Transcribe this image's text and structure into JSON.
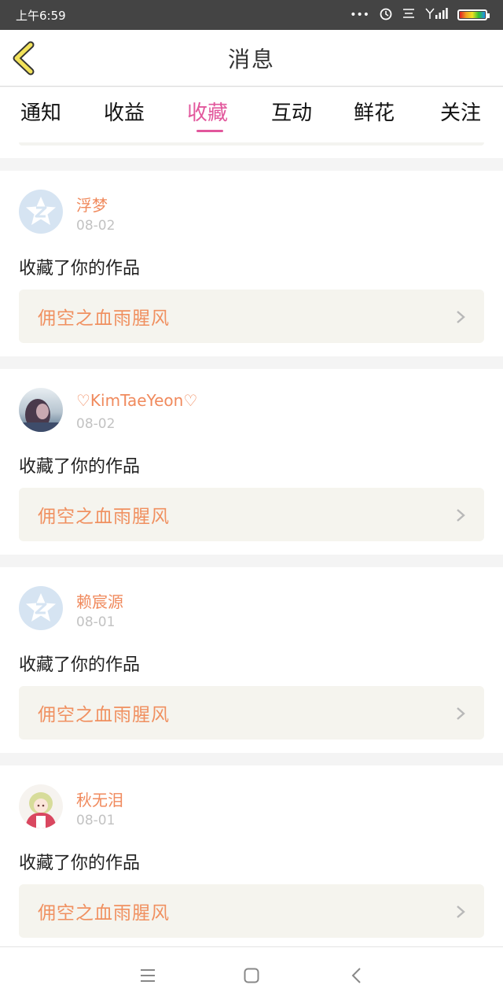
{
  "status_bar": {
    "time": "上午6:59"
  },
  "header": {
    "title": "消息"
  },
  "tabs": [
    {
      "label": "通知"
    },
    {
      "label": "收益"
    },
    {
      "label": "收藏"
    },
    {
      "label": "互动"
    },
    {
      "label": "鲜花"
    },
    {
      "label": "关注"
    }
  ],
  "active_tab": "收藏",
  "messages": [
    {
      "username": "浮梦",
      "date": "08-02",
      "action": "收藏了你的作品",
      "work_title": "佣空之血雨腥风",
      "avatar": "default"
    },
    {
      "username": "♡KimTaeYeon♡",
      "date": "08-02",
      "action": "收藏了你的作品",
      "work_title": "佣空之血雨腥风",
      "avatar": "photo"
    },
    {
      "username": "赖宸源",
      "date": "08-01",
      "action": "收藏了你的作品",
      "work_title": "佣空之血雨腥风",
      "avatar": "default"
    },
    {
      "username": "秋无泪",
      "date": "08-01",
      "action": "收藏了你的作品",
      "work_title": "佣空之血雨腥风",
      "avatar": "anime"
    }
  ],
  "icons": {
    "back": "chevron-left-icon",
    "link": "chevron-right-icon",
    "nav_menu": "menu-icon",
    "nav_home": "square-home-icon",
    "nav_back": "back-arrow-icon"
  },
  "colors": {
    "accent": "#e2579c",
    "username": "#f08a5d",
    "work_title": "#f09060",
    "back_arrow": "#f2e25a"
  }
}
